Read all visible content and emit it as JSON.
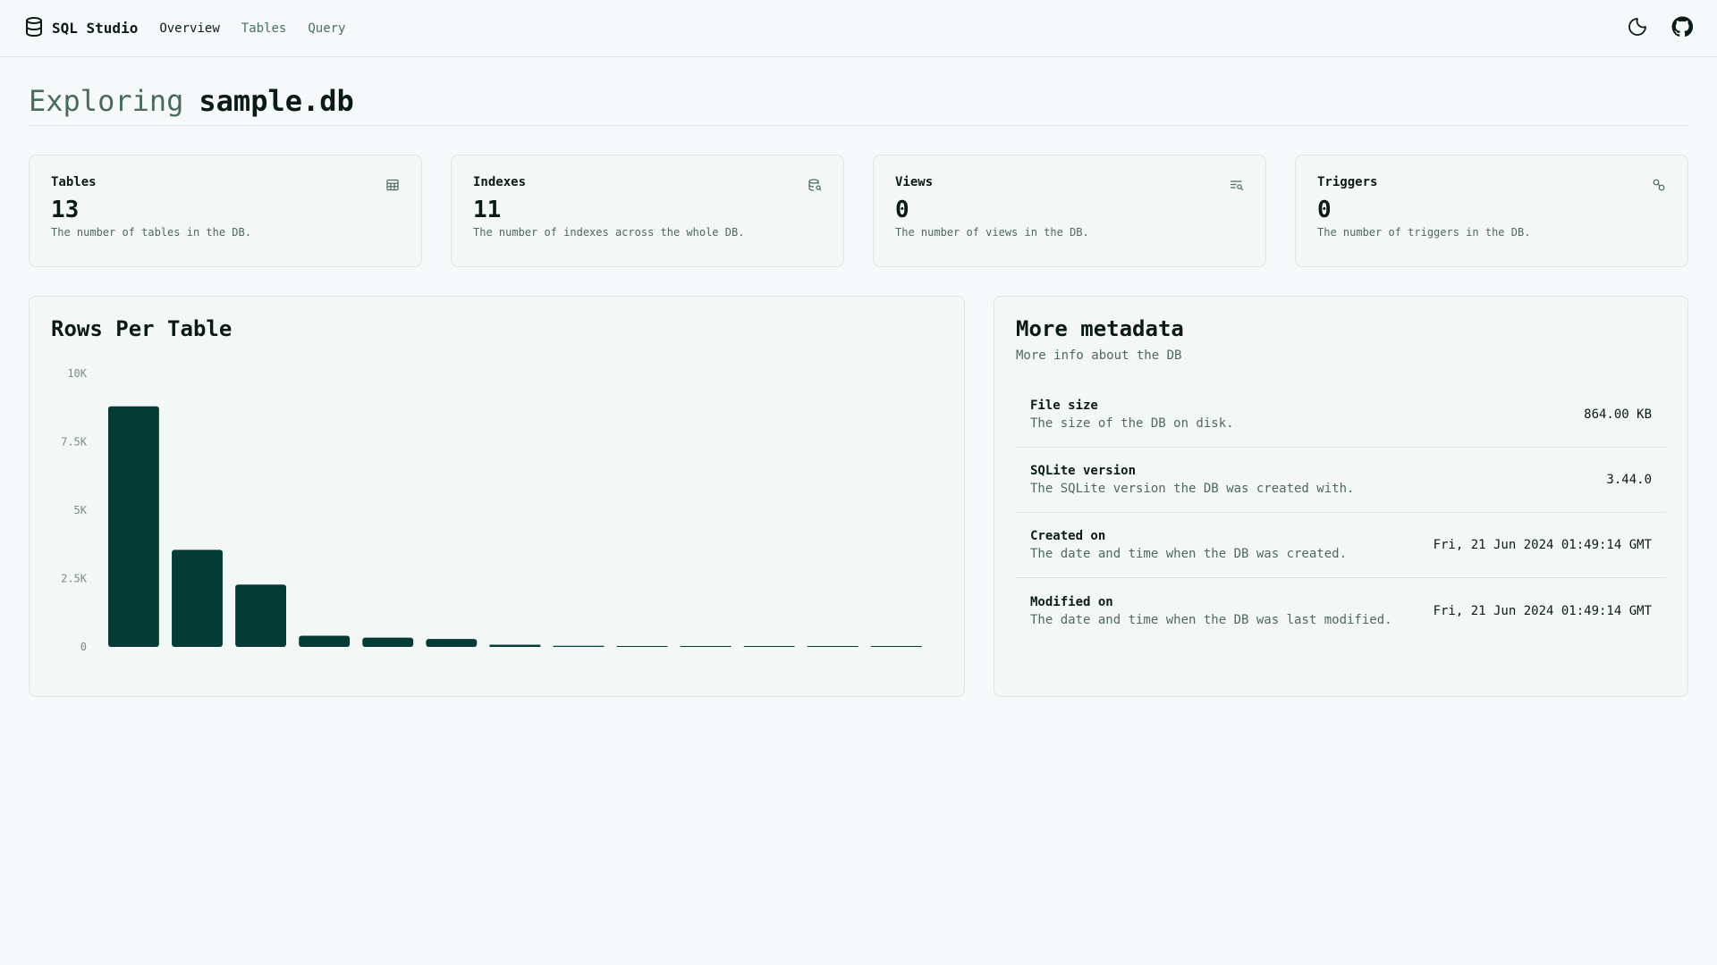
{
  "header": {
    "brand": "SQL Studio",
    "nav": [
      {
        "label": "Overview"
      },
      {
        "label": "Tables"
      },
      {
        "label": "Query"
      }
    ]
  },
  "page": {
    "title_muted": "Exploring",
    "title_db": "sample.db"
  },
  "stats": [
    {
      "title": "Tables",
      "value": "13",
      "desc": "The number of tables in the DB.",
      "icon": "table-icon"
    },
    {
      "title": "Indexes",
      "value": "11",
      "desc": "The number of indexes across the whole DB.",
      "icon": "database-search-icon"
    },
    {
      "title": "Views",
      "value": "0",
      "desc": "The number of views in the DB.",
      "icon": "list-search-icon"
    },
    {
      "title": "Triggers",
      "value": "0",
      "desc": "The number of triggers in the DB.",
      "icon": "link-icon"
    }
  ],
  "chart_card": {
    "title": "Rows Per Table"
  },
  "chart_data": {
    "type": "bar",
    "title": "Rows Per Table",
    "values": [
      8800,
      3550,
      2280,
      410,
      340,
      290,
      80,
      40,
      30,
      25,
      20,
      15,
      10
    ],
    "ylim": [
      0,
      10000
    ],
    "y_ticks": [
      {
        "value": 0,
        "label": "0"
      },
      {
        "value": 2500,
        "label": "2.5K"
      },
      {
        "value": 5000,
        "label": "5K"
      },
      {
        "value": 7500,
        "label": "7.5K"
      },
      {
        "value": 10000,
        "label": "10K"
      }
    ],
    "bar_color": "#043b35",
    "grid": false
  },
  "meta": {
    "title": "More metadata",
    "subtitle": "More info about the DB",
    "rows": [
      {
        "label": "File size",
        "desc": "The size of the DB on disk.",
        "value": "864.00 KB"
      },
      {
        "label": "SQLite version",
        "desc": "The SQLite version the DB was created with.",
        "value": "3.44.0"
      },
      {
        "label": "Created on",
        "desc": "The date and time when the DB was created.",
        "value": "Fri, 21 Jun 2024 01:49:14 GMT"
      },
      {
        "label": "Modified on",
        "desc": "The date and time when the DB was last modified.",
        "value": "Fri, 21 Jun 2024 01:49:14 GMT"
      }
    ]
  },
  "colors": {
    "accent_dark": "#043b35",
    "muted_text": "#4a6a5c"
  }
}
